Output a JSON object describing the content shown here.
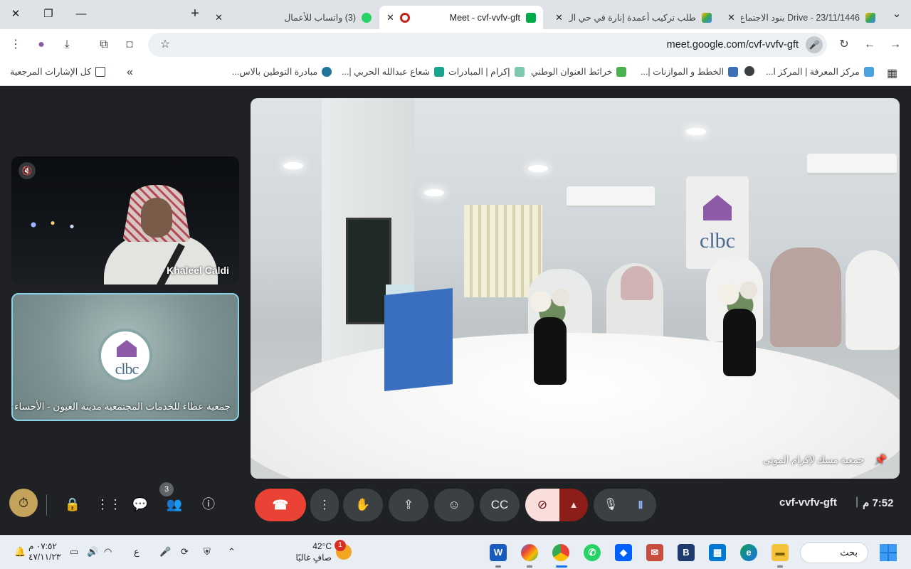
{
  "browser": {
    "tabs": [
      {
        "title": "Drive - 23/11/1446 بنود الاجتماع",
        "favicon": "google-drive-icon",
        "active": false
      },
      {
        "title": "طلب تركيب أعمدة إنارة في حي ال",
        "favicon": "google-drive-icon",
        "active": false
      },
      {
        "title": "Meet - cvf-vvfv-gft",
        "favicon": "meet-recording-icon",
        "active": true
      },
      {
        "title": "(3) واتساب للأعمال",
        "favicon": "whatsapp-icon",
        "active": false
      }
    ],
    "url": "meet.google.com/cvf-vvfv-gft",
    "bookmarks": [
      {
        "label": "مركز المعرفة | المركز ا...",
        "icon": "snowflake-icon"
      },
      {
        "label": "",
        "icon": "globe-icon"
      },
      {
        "label": "الخطط و الموازنات |...",
        "icon": "chart-icon"
      },
      {
        "label": "خرائط العنوان الوطني",
        "icon": "map-icon"
      },
      {
        "label": "إكرام | المبادرات",
        "icon": "bars-icon"
      },
      {
        "label": "شعاع عبدالله الحربي |...",
        "icon": "book-icon"
      },
      {
        "label": "مبادرة التوطين بالاس...",
        "icon": "wordpress-icon"
      }
    ],
    "all_bookmarks": "كل الإشارات المرجعية",
    "overflow": "»"
  },
  "meet": {
    "participants": {
      "camera_tile_name": "Khaleel Caldi",
      "org_tile_name": "جمعية عطاء للخدمات المجتمعية مدينة العيون - الأحساء",
      "org_logo_text": "clbc",
      "main_tile_name": "جمعية مسك لإكرام الموتى"
    },
    "main_sign_text": "clbc",
    "people_count": "3",
    "meeting_code": "cvf-vvfv-gft",
    "separator": "|",
    "time": "7:52 م"
  },
  "taskbar": {
    "clock_time": "٠٧:٥٢ م",
    "clock_date": "٤٧/١١/٢٣",
    "lang": "ع",
    "weather_temp": "42°C",
    "weather_desc": "صافٍ غالبًا",
    "weather_badge": "1",
    "search_label": "بحث"
  },
  "colors": {
    "accent": "#8ab4f8",
    "hangup": "#ea4335",
    "tile_highlight": "#8ad0e6",
    "brand_purple": "#8c5aa6"
  }
}
